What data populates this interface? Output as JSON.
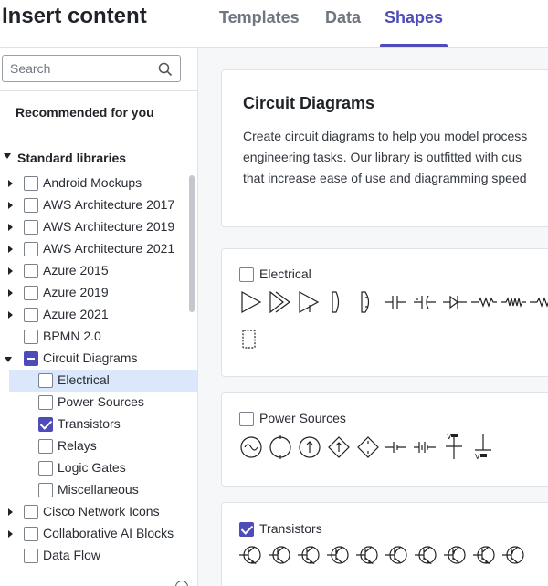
{
  "header": {
    "title": "Insert content",
    "tabs": [
      {
        "label": "Templates",
        "active": false
      },
      {
        "label": "Data",
        "active": false
      },
      {
        "label": "Shapes",
        "active": true
      }
    ]
  },
  "sidebar": {
    "search_placeholder": "Search",
    "recommended_label": "Recommended for you",
    "standard_libraries_label": "Standard libraries",
    "libraries": [
      {
        "label": "Android Mockups",
        "state": "unchecked",
        "expandable": true
      },
      {
        "label": "AWS Architecture 2017",
        "state": "unchecked",
        "expandable": true
      },
      {
        "label": "AWS Architecture 2019",
        "state": "unchecked",
        "expandable": true
      },
      {
        "label": "AWS Architecture 2021",
        "state": "unchecked",
        "expandable": true
      },
      {
        "label": "Azure 2015",
        "state": "unchecked",
        "expandable": true
      },
      {
        "label": "Azure 2019",
        "state": "unchecked",
        "expandable": true
      },
      {
        "label": "Azure 2021",
        "state": "unchecked",
        "expandable": true
      },
      {
        "label": "BPMN 2.0",
        "state": "unchecked",
        "expandable": false
      },
      {
        "label": "Circuit Diagrams",
        "state": "indeterminate",
        "expandable": true,
        "expanded": true
      },
      {
        "label": "Electrical",
        "state": "unchecked",
        "child": true,
        "highlighted": true
      },
      {
        "label": "Power Sources",
        "state": "unchecked",
        "child": true
      },
      {
        "label": "Transistors",
        "state": "checked",
        "child": true
      },
      {
        "label": "Relays",
        "state": "unchecked",
        "child": true
      },
      {
        "label": "Logic Gates",
        "state": "unchecked",
        "child": true
      },
      {
        "label": "Miscellaneous",
        "state": "unchecked",
        "child": true
      },
      {
        "label": "Cisco Network Icons",
        "state": "unchecked",
        "expandable": true
      },
      {
        "label": "Collaborative AI Blocks",
        "state": "unchecked",
        "expandable": true
      },
      {
        "label": "Data Flow",
        "state": "unchecked",
        "expandable": false
      }
    ]
  },
  "main": {
    "intro": {
      "title": "Circuit Diagrams",
      "lines": [
        "Create circuit diagrams to help you model process",
        "engineering tasks. Our library is outfitted with cus",
        "that increase ease of use and diagramming speed"
      ]
    },
    "sections": {
      "electrical": {
        "label": "Electrical",
        "checked": false
      },
      "power_sources": {
        "label": "Power Sources",
        "checked": false
      },
      "transistors": {
        "label": "Transistors",
        "checked": true
      }
    }
  },
  "colors": {
    "accent": "#4e4cb8",
    "highlight_row": "#dbe8fb",
    "panel_bg": "#f5f7f9",
    "border": "#dfe3e8"
  }
}
